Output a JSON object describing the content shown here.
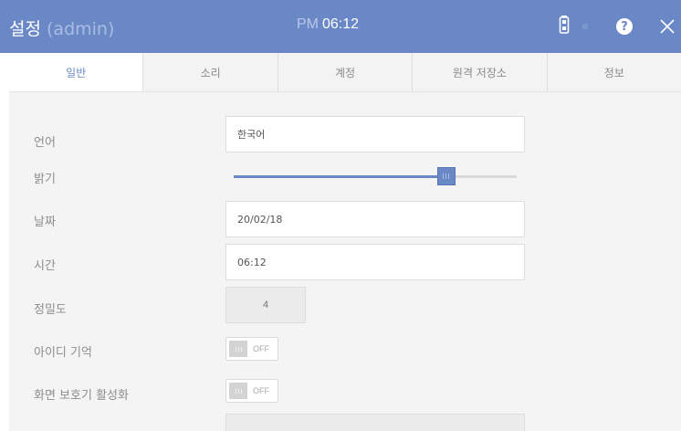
{
  "header": {
    "title": "설정",
    "user": "(admin)",
    "time_ampm": "PM",
    "time_value": "06:12",
    "status_icon": "battery-icon",
    "help_label": "?",
    "accent_color": "#6a88c6"
  },
  "tabs": [
    {
      "label": "일반",
      "active": true
    },
    {
      "label": "소리",
      "active": false
    },
    {
      "label": "계정",
      "active": false
    },
    {
      "label": "원격 저장소",
      "active": false
    },
    {
      "label": "정보",
      "active": false
    }
  ],
  "settings": {
    "language": {
      "label": "언어",
      "value": "한국어"
    },
    "brightness": {
      "label": "밝기",
      "level": 0.75
    },
    "date": {
      "label": "날짜",
      "value": "20/02/18"
    },
    "time": {
      "label": "시간",
      "value": "06:12"
    },
    "precision": {
      "label": "정밀도",
      "value": "4"
    },
    "remember_id": {
      "label": "아이디 기억",
      "state": "OFF"
    },
    "screensaver": {
      "label": "화면 보호기 활성화",
      "state": "OFF"
    }
  }
}
